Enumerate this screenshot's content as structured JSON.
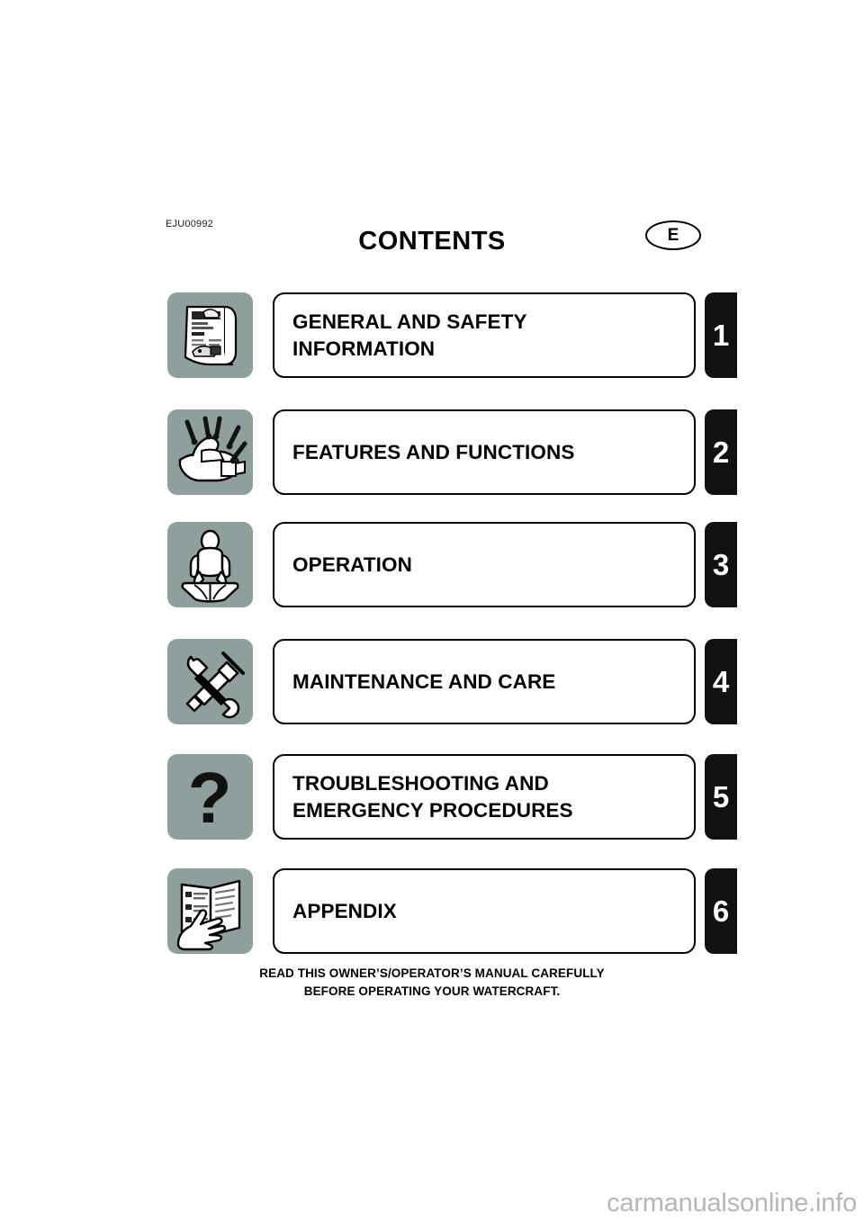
{
  "header": {
    "doc_code": "EJU00992",
    "title": "CONTENTS",
    "language_badge": "E"
  },
  "sections": [
    {
      "number": "1",
      "title": "GENERAL AND SAFETY\nINFORMATION",
      "icon": "manual-page-icon"
    },
    {
      "number": "2",
      "title": "FEATURES AND FUNCTIONS",
      "icon": "watercraft-features-icon"
    },
    {
      "number": "3",
      "title": "OPERATION",
      "icon": "rider-on-watercraft-icon"
    },
    {
      "number": "4",
      "title": "MAINTENANCE AND CARE",
      "icon": "wrench-and-grease-gun-icon"
    },
    {
      "number": "5",
      "title": "TROUBLESHOOTING AND\nEMERGENCY PROCEDURES",
      "icon": "question-mark-icon"
    },
    {
      "number": "6",
      "title": "APPENDIX",
      "icon": "open-book-hand-icon"
    }
  ],
  "footer": {
    "note": "READ THIS OWNER’S/OPERATOR’S MANUAL CAREFULLY\nBEFORE OPERATING YOUR WATERCRAFT."
  },
  "watermark": {
    "text": "carmanualsonline.info"
  },
  "colors": {
    "icon_box_background": "#8e9f9d",
    "tab_background": "#111111",
    "tab_text": "#ffffff",
    "page_background": "#ffffff",
    "watermark_text": "#b6b6b6"
  }
}
